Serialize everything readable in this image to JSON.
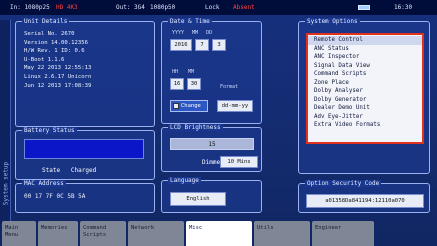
{
  "status": {
    "input": "In: 1080p25",
    "hd": "HD 4K3",
    "output": "Out: 3G4",
    "format": "1080p50",
    "lock": "Lock",
    "reference": "Absent",
    "time": "16:30"
  },
  "side_label": "System setup",
  "unit_details": {
    "title": "Unit Details",
    "rows": [
      "Serial No. 2670",
      "Version 14.00.12356",
      "H/W Rev. 1  ID: 0.6",
      "U-Boot 1.1.6",
      "May 22 2013 12:55:13",
      "Linux 2.6.17 Unicorn",
      "Jun 12 2013 17:08:39"
    ]
  },
  "battery": {
    "title": "Battery Status",
    "state_label": "State",
    "state_value": "Charged"
  },
  "mac": {
    "title": "MAC Address",
    "value": "00 17 7F 0C 5B 5A"
  },
  "date_time": {
    "title": "Date & Time",
    "date_headers": [
      "YYYY",
      "MM",
      "DD"
    ],
    "year": "2016",
    "month": "7",
    "day": "3",
    "time_headers": [
      "HH",
      "MM"
    ],
    "hour": "16",
    "minute": "30",
    "format_label": "Format",
    "change_label": "Change",
    "format_value": "dd-mm-yy"
  },
  "lcd": {
    "title": "LCD Brightness",
    "brightness": "15",
    "dimmer_label": "Dimmer",
    "dimmer_value": "10 Mins"
  },
  "language": {
    "title": "Language",
    "value": "English"
  },
  "options": {
    "title": "System Options",
    "items": [
      "Remote Control",
      "ANC Status",
      "ANC Inspector",
      "Signal Data View",
      "Command Scripts",
      "Zone Place",
      "Dolby Analyser",
      "Dolby Generator",
      "Dealer Demo Unit",
      "Adv Eye-Jitter",
      "Extra Video Formats"
    ]
  },
  "security": {
    "title": "Option Security Code",
    "value": "a01358Da841194:12110a070"
  },
  "tabs": [
    "Main Menu",
    "Memories",
    "Command Scripts",
    "Network",
    "Misc",
    "Utils",
    "Engineer"
  ],
  "colors": {
    "background": "#17307e",
    "alert": "#ff4040",
    "selection_border": "#e0301e",
    "active_tab": "#ffffff"
  }
}
